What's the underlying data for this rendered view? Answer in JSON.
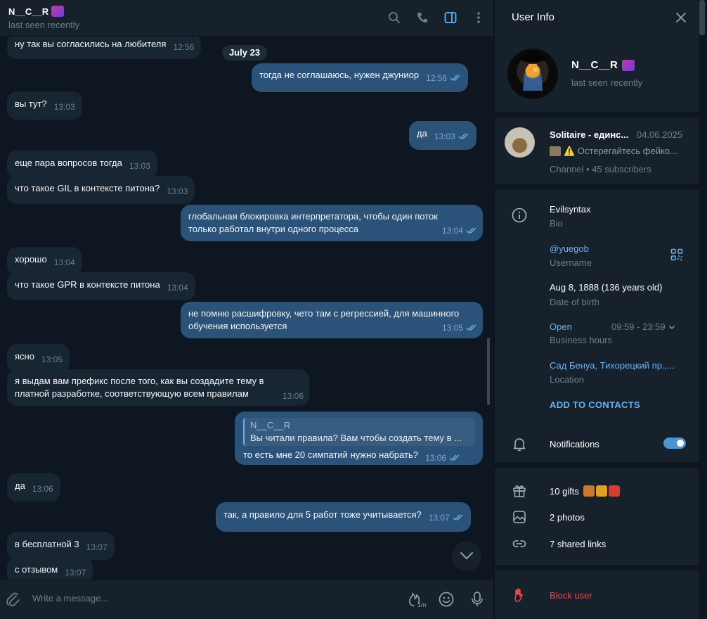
{
  "chat": {
    "title": "N__C__R",
    "status": "last seen recently",
    "date_separator": "July 23",
    "composer_placeholder": "Write a message...",
    "slowmode_label": "1m",
    "messages": [
      {
        "dir": "in",
        "text": "ну так вы согласились на любителя",
        "time": "12:56"
      },
      {
        "dir": "out",
        "text": "тогда не соглашаюсь, нужен джуниор",
        "time": "12:56"
      },
      {
        "dir": "in",
        "text": "вы тут?",
        "time": "13:03"
      },
      {
        "dir": "out",
        "text": "да",
        "time": "13:03"
      },
      {
        "dir": "in",
        "text": "еще пара вопросов тогда",
        "time": "13:03"
      },
      {
        "dir": "in",
        "text": "что такое GIL в контексте питона?",
        "time": "13:03"
      },
      {
        "dir": "out",
        "text": "глобальная блокировка интерпретатора, чтобы один поток только работал внутри одного процесса",
        "time": "13:04"
      },
      {
        "dir": "in",
        "text": "хорошо",
        "time": "13:04"
      },
      {
        "dir": "in",
        "text": "что такое GPR в контексте питона",
        "time": "13:04"
      },
      {
        "dir": "out",
        "text": "не помню расшифровку, чето там с регрессией, для машинного обучения используется",
        "time": "13:05"
      },
      {
        "dir": "in",
        "text": "ясно",
        "time": "13:05"
      },
      {
        "dir": "in",
        "text": "я выдам вам префикс после того, как вы создадите тему в платной разработке, соответствующую всем правилам",
        "time": "13:06"
      },
      {
        "dir": "out",
        "reply_name": "N__C__R",
        "reply_text": "Вы читали правила? Вам чтобы создать тему в ...",
        "text": "то есть мне 20 симпатий нужно набрать?",
        "time": "13:06"
      },
      {
        "dir": "in",
        "text": "да",
        "time": "13:06"
      },
      {
        "dir": "out",
        "text": "так, а правило для 5 работ тоже учитывается?",
        "time": "13:07"
      },
      {
        "dir": "in",
        "text": "в бесплатной 3",
        "time": "13:07"
      },
      {
        "dir": "in",
        "text": "с отзывом",
        "time": "13:07"
      }
    ]
  },
  "panel": {
    "title": "User Info",
    "name": "N__C__R",
    "status": "last seen recently",
    "channel": {
      "name": "Solitaire - единс...",
      "date": "04.06.2025",
      "preview": "⚠️ Остерегайтесь фейко...",
      "meta": "Channel • 45 subscribers"
    },
    "bio_value": "Evilsyntax",
    "bio_label": "Bio",
    "username_value": "@yuegob",
    "username_label": "Username",
    "birth_value": "Aug 8, 1888 (136 years old)",
    "birth_label": "Date of birth",
    "hours_value": "Open",
    "hours_time": "09:59 - 23:59",
    "hours_label": "Business hours",
    "location_value": "Сад Бенуа, Тихорецкий пр.,...",
    "location_label": "Location",
    "add_contacts": "ADD TO CONTACTS",
    "notifications": "Notifications",
    "notifications_on": true,
    "gifts": "10 gifts",
    "photos": "2 photos",
    "links": "7 shared links",
    "block": "Block user"
  },
  "colors": {
    "accent": "#6ab3f3",
    "outgoing_bubble": "#2b5278",
    "incoming_bubble": "#182533",
    "danger": "#e5474b"
  }
}
